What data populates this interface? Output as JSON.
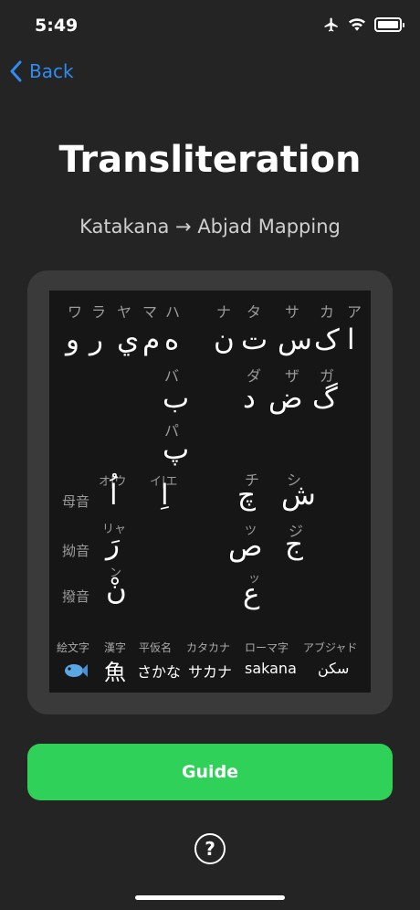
{
  "status": {
    "time": "5:49",
    "icons": [
      "airplane-icon",
      "wifi-icon",
      "battery-icon"
    ]
  },
  "nav": {
    "back_label": "Back"
  },
  "title": "Transliteration",
  "subtitle": "Katakana → Abjad Mapping",
  "chart": {
    "kana_row": [
      "ワ",
      "ラ",
      "ヤ",
      "マ",
      "ハ",
      "ナ",
      "タ",
      "サ",
      "カ",
      "ア"
    ],
    "abjad_row1": [
      "و",
      "ر",
      "ي",
      "م",
      "ه",
      "ن",
      "ت",
      "س",
      "ک",
      "ا"
    ],
    "voiced_kana": [
      "バ",
      "ダ",
      "ザ",
      "ガ"
    ],
    "voiced_abjad": [
      "ب",
      "د",
      "ض",
      "گ"
    ],
    "p_kana": "パ",
    "p_abjad": "پ",
    "vowel_kana": [
      "オ|ウ",
      "イ|エ",
      "チ",
      "シ"
    ],
    "row_vowels": {
      "label": "母音",
      "chars": [
        "اُ",
        "اِ",
        "چ",
        "ش"
      ]
    },
    "small_kana": [
      "リャ",
      "ツ",
      "ジ"
    ],
    "row_yoon": {
      "label": "拗音",
      "chars": [
        "رَ",
        "ص",
        "ج"
      ]
    },
    "small_kana2": [
      "ン",
      "ッ"
    ],
    "row_hatsuon": {
      "label": "撥音",
      "chars": [
        "نْ",
        "ع"
      ]
    },
    "example_headers": [
      "絵文字",
      "漢字",
      "平仮名",
      "カタカナ",
      "ローマ字",
      "アブジャド"
    ],
    "example_values": [
      "魚",
      "さかな",
      "サカナ",
      "sakana",
      "سکن"
    ],
    "fish_emoji": "fish-icon"
  },
  "buttons": {
    "guide_label": "Guide",
    "help_icon": "help-icon",
    "help_glyph": "?"
  },
  "colors": {
    "accent_blue": "#2f8cf0",
    "button_green": "#2fd158",
    "background": "#242424",
    "card": "#3a3a3a"
  }
}
